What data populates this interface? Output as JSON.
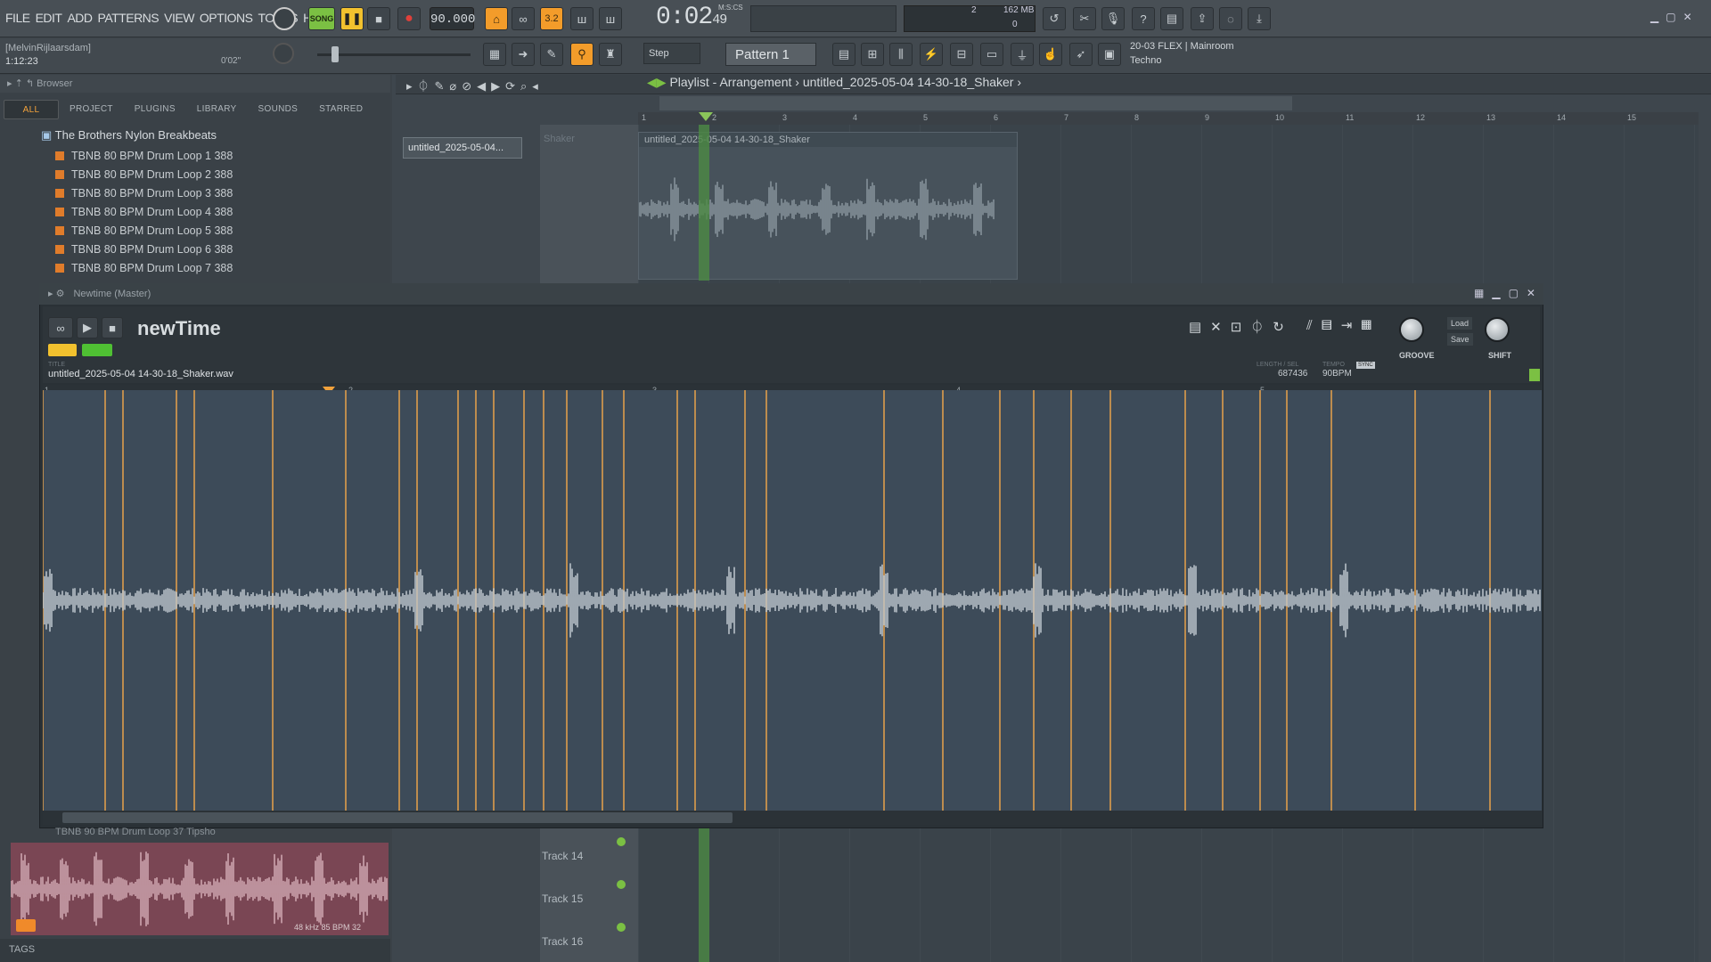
{
  "menu": [
    "FILE",
    "EDIT",
    "ADD",
    "PATTERNS",
    "VIEW",
    "OPTIONS",
    "TOOLS",
    "HELP"
  ],
  "transport": {
    "mode": "SONG",
    "bpm": "90.000",
    "time": "0:02",
    "time_small": "49",
    "time_label": "M:S:CS",
    "cpu": "2",
    "mem": "162 MB",
    "mem2": "0"
  },
  "hint": {
    "user": "[MelvinRijlaarsdam]",
    "position": "1:12:23",
    "secs": "0'02\""
  },
  "toolbar2": {
    "step": "Step",
    "pattern": "Pattern 1",
    "news_date": "20-03",
    "news_line1": "FLEX | Mainroom",
    "news_line2": "Techno"
  },
  "browser": {
    "title": "Browser",
    "tabs": [
      "ALL",
      "PROJECT",
      "PLUGINS",
      "LIBRARY",
      "SOUNDS",
      "STARRED"
    ],
    "folder": "The Brothers Nylon Breakbeats",
    "files": [
      "TBNB 80 BPM Drum Loop 1 388",
      "TBNB 80 BPM Drum Loop 2 388",
      "TBNB 80 BPM Drum Loop 3 388",
      "TBNB 80 BPM Drum Loop 4 388",
      "TBNB 80 BPM Drum Loop 5 388",
      "TBNB 80 BPM Drum Loop 6 388",
      "TBNB 80 BPM Drum Loop 7 388"
    ],
    "partial_file": "TBNB 90 BPM Drum Loop 37 Tipsho",
    "preview_info": "48 kHz 85 BPM 32",
    "tags": "TAGS"
  },
  "playlist": {
    "breadcrumb": "Playlist - Arrangement",
    "pattern": "untitled_2025-05-04 14-30-18_Shaker",
    "picker_item": "untitled_2025-05-04...",
    "track_name": "Shaker",
    "clip_label": "untitled_2025-05-04 14-30-18_Shaker",
    "bars": [
      "1",
      "2",
      "3",
      "4",
      "5",
      "6",
      "7",
      "8",
      "9",
      "10",
      "11",
      "12",
      "13",
      "14",
      "15"
    ],
    "tracks": [
      "Track 14",
      "Track 15",
      "Track 16"
    ]
  },
  "newtime": {
    "window_title": "Newtime (Master)",
    "logo": "newTime",
    "file": "untitled_2025-05-04 14-30-18_Shaker.wav",
    "file_label": "TITLE",
    "length_label": "LENGTH / SEL",
    "length": "687436",
    "tempo_label": "TEMPO",
    "tempo": "90BPM",
    "sync": "SYNC",
    "groove": "GROOVE",
    "shift": "SHIFT",
    "load": "Load",
    "save": "Save",
    "bars": [
      "1",
      "2",
      "3",
      "4",
      "5"
    ]
  },
  "colors": {
    "accent": "#f39c2a",
    "green": "#7bc043",
    "wave": "#d8e1e8",
    "marker": "#e8a24a"
  }
}
